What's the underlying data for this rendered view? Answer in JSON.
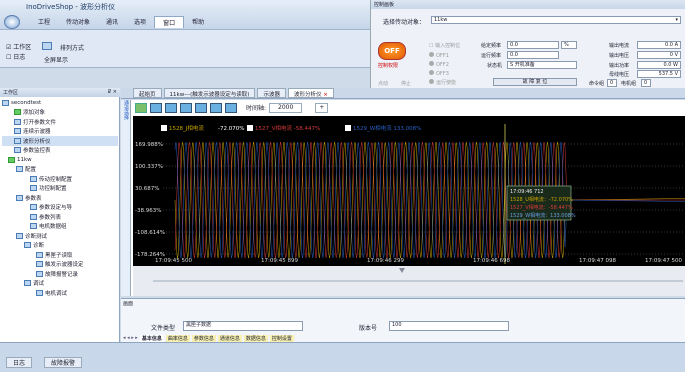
{
  "app": {
    "title": "InoDriveShop - 波形分析仪",
    "menu": [
      "工程",
      "传动对象",
      "通讯",
      "选项",
      "窗口",
      "帮助"
    ],
    "active_menu": 4
  },
  "ribbon": {
    "item1": "工作区",
    "item2": "日志",
    "item3": "排列方式",
    "item4": "全屏显示"
  },
  "control": {
    "header": "控制画板",
    "select_label": "选择传动对象：",
    "select_value": "11kw",
    "off_label": "OFF",
    "ctrl_label": "控制权限",
    "checkbox_label": "输入控制位",
    "states": [
      "OFF1",
      "OFF2",
      "OFF3",
      "运行使能"
    ],
    "bottom_labels": [
      "点动",
      "停止"
    ],
    "set_freq_label": "给定频率",
    "set_freq_value": "0.0",
    "set_freq_unit": "%",
    "run_freq_label": "运行频率",
    "run_freq_value": "0.0",
    "status_label": "状态机",
    "status_value": "S 开机准备",
    "reset_label": "故 障 复 位",
    "out_current_label": "输出电流",
    "out_current_value": "0.0 A",
    "out_voltage_label": "输出电压",
    "out_voltage_value": "0 V",
    "out_power_label": "输出功率",
    "out_power_value": "0.0 W",
    "bus_voltage_label": "母线电压",
    "bus_voltage_value": "537.5 V",
    "cmd_label": "命令组",
    "cmd_value": "0",
    "motor_label": "电机组",
    "motor_value": "0"
  },
  "workspace": {
    "header": "工作区",
    "pin": "₽ ×",
    "items": [
      "secondtest",
      "添加对象",
      "打开参数文件",
      "连续示波器",
      "波形分析仪",
      "参数监控表",
      "11kw",
      "配置",
      "传动控制配置",
      "功控制配置",
      "参数表",
      "参数设定与导",
      "参数列表",
      "电机数据组",
      "诊断测试",
      "诊断",
      "黑匣子读取",
      "触发示波器设定",
      "故障报警记录",
      "调试",
      "电机调试"
    ]
  },
  "doc_tabs": [
    "起始页",
    "11kw---(触发示波器设定与读取)",
    "示波器",
    "波形分析仪"
  ],
  "plot": {
    "time_label": "时间轴:",
    "time_value": "2000",
    "add": "+",
    "side_label": "通道选择",
    "legend": [
      "1528_J相电流",
      "-72.070%",
      "1527_V相电流 -58.447%",
      "1529_W相电流 133.008%"
    ],
    "y_ticks": [
      "169.988%",
      "100.337%",
      "30.687%",
      "-38.963%",
      "-108.614%",
      "-178.264%"
    ],
    "x_ticks": [
      "17:09:45 500",
      "17:09:45 899",
      "17:09:46 299",
      "17:09:46 698",
      "17:09:47 098",
      "17:09:47 500"
    ],
    "tooltip": [
      "17:09:46 712",
      "1528_U相电流：-72.070%",
      "1527_V相电流：-58.447%",
      "1529_W相电流：133.008%"
    ],
    "colors": {
      "u": "#c8a400",
      "v": "#d23a3a",
      "w": "#2a5fc4",
      "bg": "#000000"
    }
  },
  "bottom": {
    "header": "画面",
    "file_type_label": "文件类型",
    "file_type_value": "黑匣子数据",
    "version_label": "版本号",
    "version_value": "100",
    "tabs": [
      "基本信息",
      "曲率信息",
      "参数信息",
      "通道信息",
      "数据信息",
      "控制设置"
    ]
  },
  "status": {
    "log": "日志",
    "fault": "故障报警"
  }
}
